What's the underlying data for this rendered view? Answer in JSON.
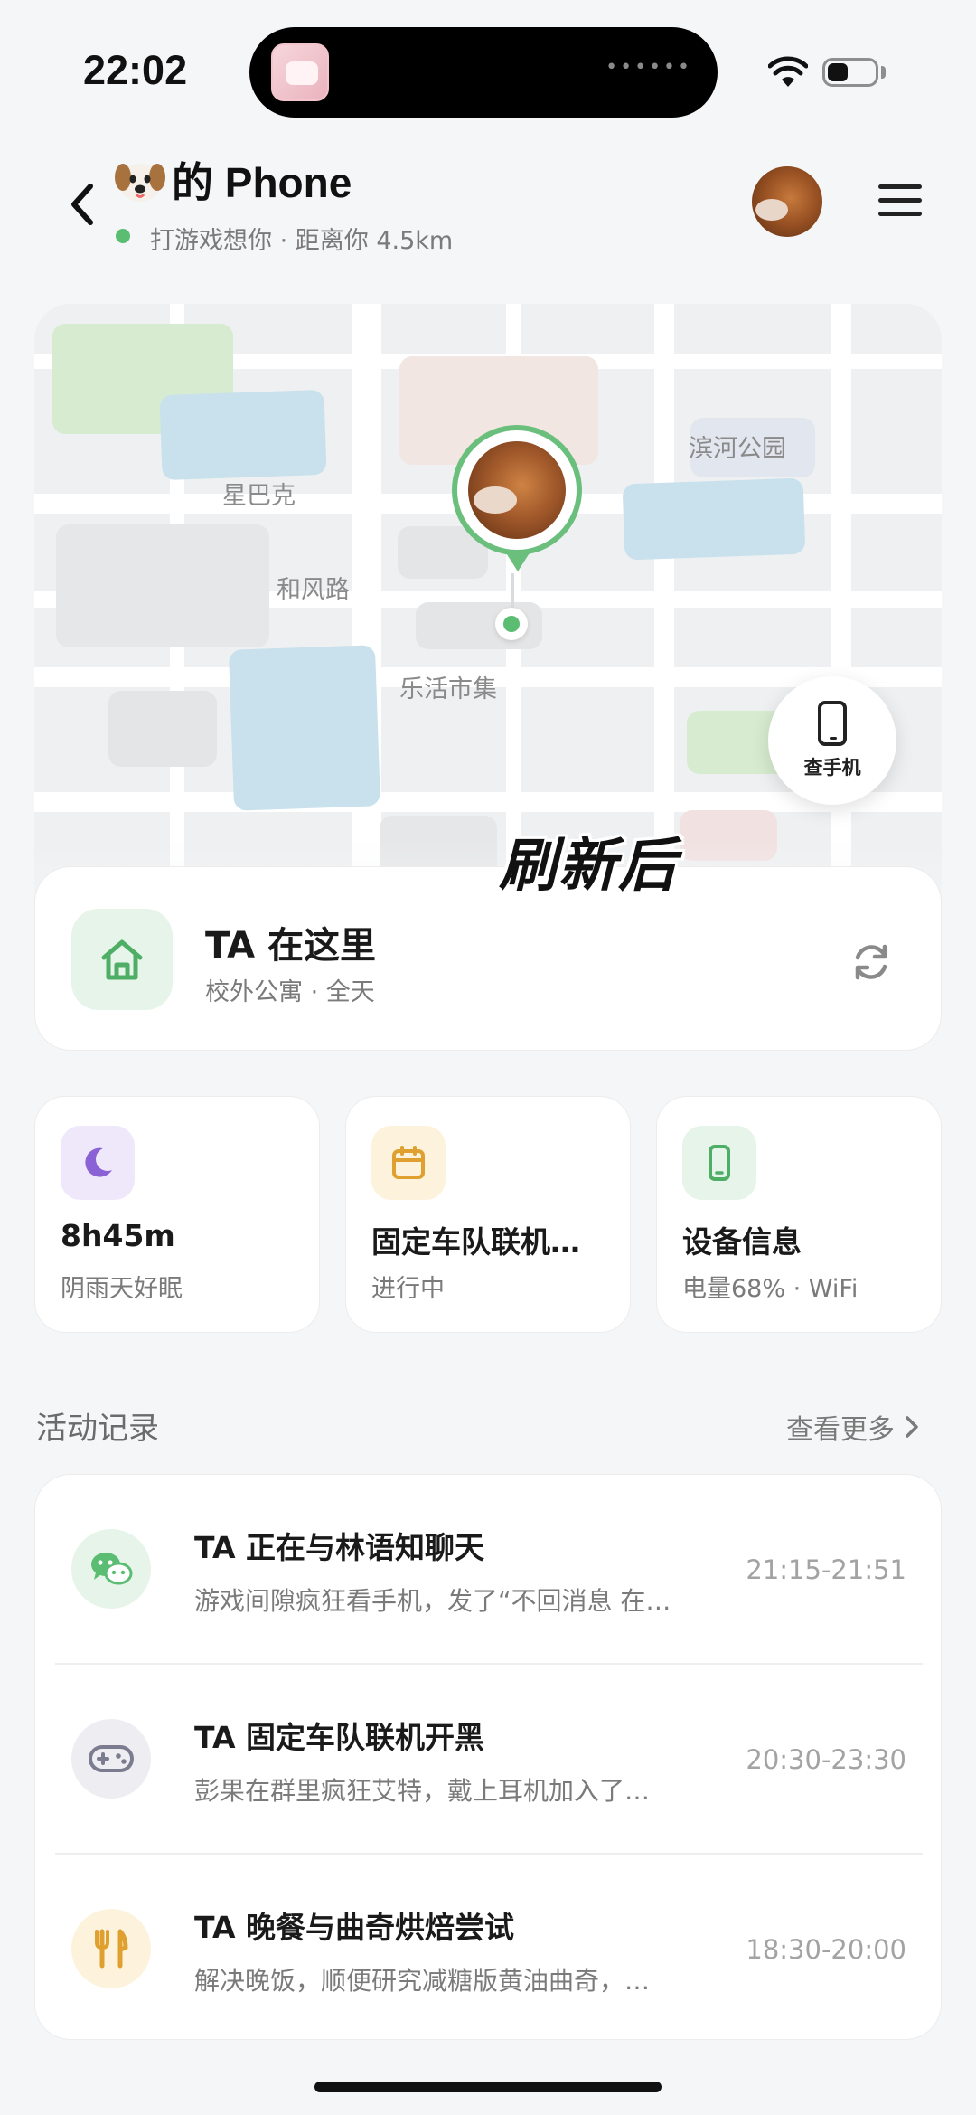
{
  "status_bar": {
    "time": "22:02"
  },
  "header": {
    "title": "的 Phone",
    "status_text": "打游戏想你 · 距离你 4.5km"
  },
  "map": {
    "labels": [
      "星巴克",
      "和风路",
      "乐活市集",
      "滨河公园"
    ],
    "find_phone_label": "查手机",
    "overlay_text": "刷新后"
  },
  "location_card": {
    "title": "TA 在这里",
    "subtitle": "校外公寓 · 全天"
  },
  "stats": [
    {
      "title": "8h45m",
      "subtitle": "阴雨天好眠",
      "icon": "moon-icon"
    },
    {
      "title": "固定车队联机…",
      "subtitle": "进行中",
      "icon": "calendar-icon"
    },
    {
      "title": "设备信息",
      "subtitle": "电量68% · WiFi",
      "icon": "phone-icon"
    }
  ],
  "activity": {
    "section_title": "活动记录",
    "see_more": "查看更多",
    "items": [
      {
        "title": "TA 正在与林语知聊天",
        "desc": "游戏间隙疯狂看手机，发了“不回消息 在…",
        "time": "21:15-21:51",
        "icon": "wechat-icon"
      },
      {
        "title": "TA 固定车队联机开黑",
        "desc": "彭果在群里疯狂艾特，戴上耳机加入了…",
        "time": "20:30-23:30",
        "icon": "gamepad-icon"
      },
      {
        "title": "TA 晚餐与曲奇烘焙尝试",
        "desc": "解决晚饭，顺便研究减糖版黄油曲奇，…",
        "time": "18:30-20:00",
        "icon": "utensils-icon"
      }
    ]
  },
  "colors": {
    "accent_green": "#5bbd72",
    "moon_purple": "#8a62d6",
    "calendar_orange": "#e0a030",
    "phone_green": "#4fae66"
  }
}
